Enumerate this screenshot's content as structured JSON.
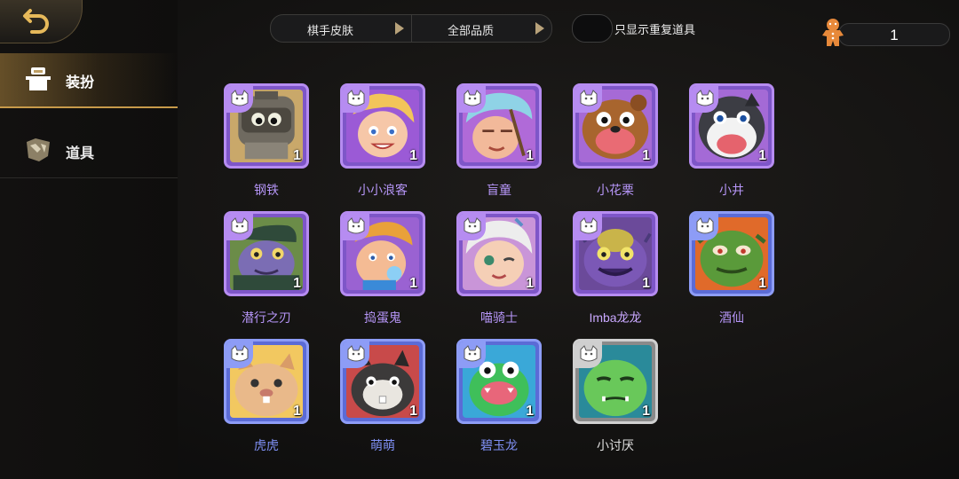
{
  "sidebar": {
    "items": [
      {
        "label": "装扮",
        "icon": "shirt-icon",
        "active": true
      },
      {
        "label": "道具",
        "icon": "item-rock-icon",
        "active": false
      }
    ]
  },
  "toolbar": {
    "filter_category": "棋手皮肤",
    "filter_quality": "全部品质",
    "toggle_label": "只显示重复道具",
    "currency_value": "1",
    "currency_icon": "gingerbread-icon"
  },
  "items": [
    {
      "name": "钢铁",
      "count": "1",
      "rarity": "purple"
    },
    {
      "name": "小小浪客",
      "count": "1",
      "rarity": "purple"
    },
    {
      "name": "盲童",
      "count": "1",
      "rarity": "purple"
    },
    {
      "name": "小花栗",
      "count": "1",
      "rarity": "purple"
    },
    {
      "name": "小井",
      "count": "1",
      "rarity": "purple"
    },
    {
      "name": "潜行之刃",
      "count": "1",
      "rarity": "purple"
    },
    {
      "name": "捣蛋鬼",
      "count": "1",
      "rarity": "purple"
    },
    {
      "name": "喵骑士",
      "count": "1",
      "rarity": "purple"
    },
    {
      "name": "Imba龙龙",
      "count": "1",
      "rarity": "purple"
    },
    {
      "name": "酒仙",
      "count": "1",
      "rarity": "blue"
    },
    {
      "name": "虎虎",
      "count": "1",
      "rarity": "blue"
    },
    {
      "name": "萌萌",
      "count": "1",
      "rarity": "blue"
    },
    {
      "name": "碧玉龙",
      "count": "1",
      "rarity": "blue"
    },
    {
      "name": "小讨厌",
      "count": "1",
      "rarity": "grey"
    }
  ],
  "colors": {
    "purple": "#b68cf1",
    "blue": "#8d9cf6",
    "grey": "#d0d0d0",
    "accent_gold": "#c79a4a"
  }
}
